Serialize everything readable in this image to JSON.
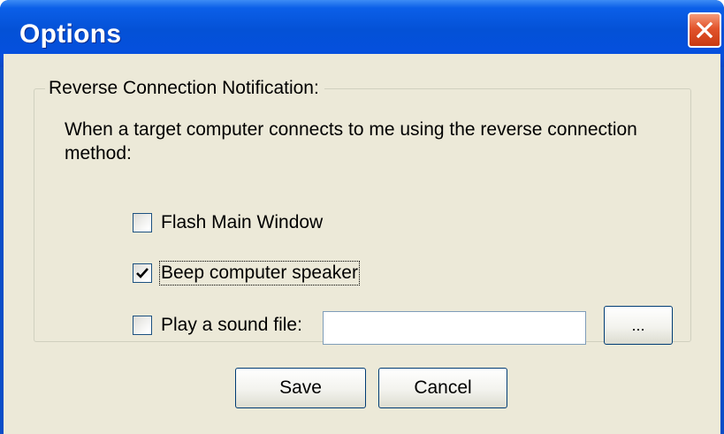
{
  "window": {
    "title": "Options"
  },
  "group": {
    "label": "Reverse Connection Notification:",
    "description": "When a target computer connects to me using the reverse connection method:"
  },
  "options": [
    {
      "label": "Flash Main Window",
      "checked": false
    },
    {
      "label": "Beep computer speaker",
      "checked": true
    },
    {
      "label": "Play a sound file:",
      "checked": false
    }
  ],
  "sound_file": {
    "value": "",
    "browse_label": "..."
  },
  "buttons": {
    "save_label": "Save",
    "cancel_label": "Cancel"
  },
  "colors": {
    "titlebar": "#0451d6",
    "dialog_face": "#ece9d8",
    "close_button": "#e2542c"
  },
  "icons": {
    "close": "close-icon",
    "check": "checkmark-icon"
  }
}
